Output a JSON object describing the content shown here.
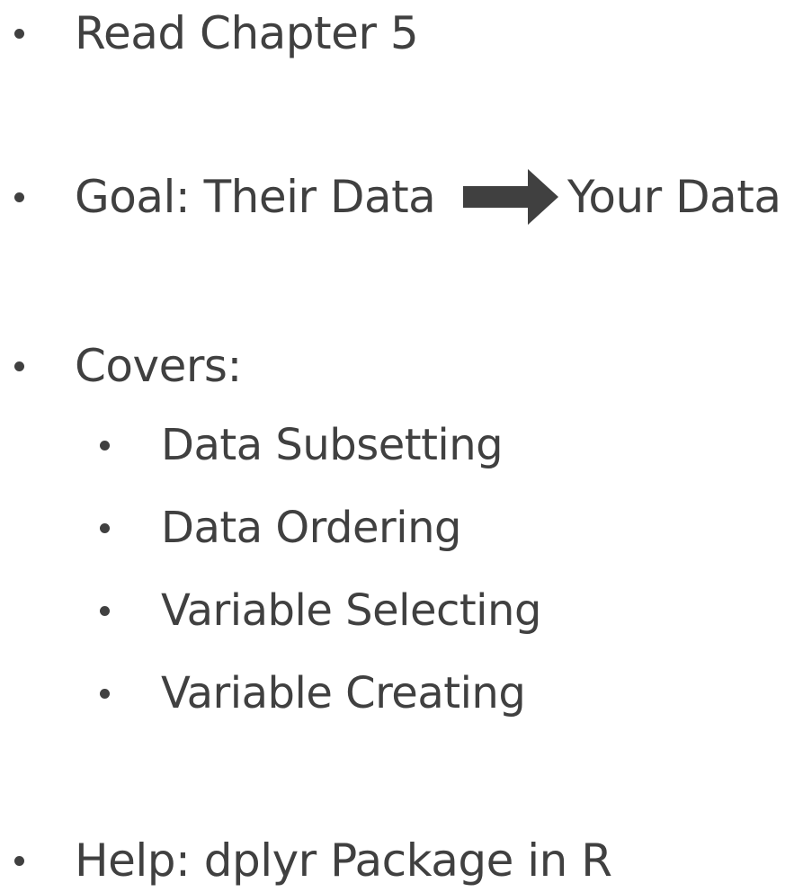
{
  "bullets": {
    "read": "Read Chapter 5",
    "goal": {
      "prefix": "Goal: Their Data",
      "suffix": "Your Data",
      "arrow_icon": "right-arrow-icon"
    },
    "covers": {
      "label": "Covers:",
      "subitems": [
        "Data Subsetting",
        "Data Ordering",
        "Variable Selecting",
        "Variable Creating"
      ]
    },
    "help": "Help: dplyr Package in R"
  },
  "colors": {
    "text": "#404040",
    "arrow": "#404040",
    "background": "#ffffff"
  }
}
